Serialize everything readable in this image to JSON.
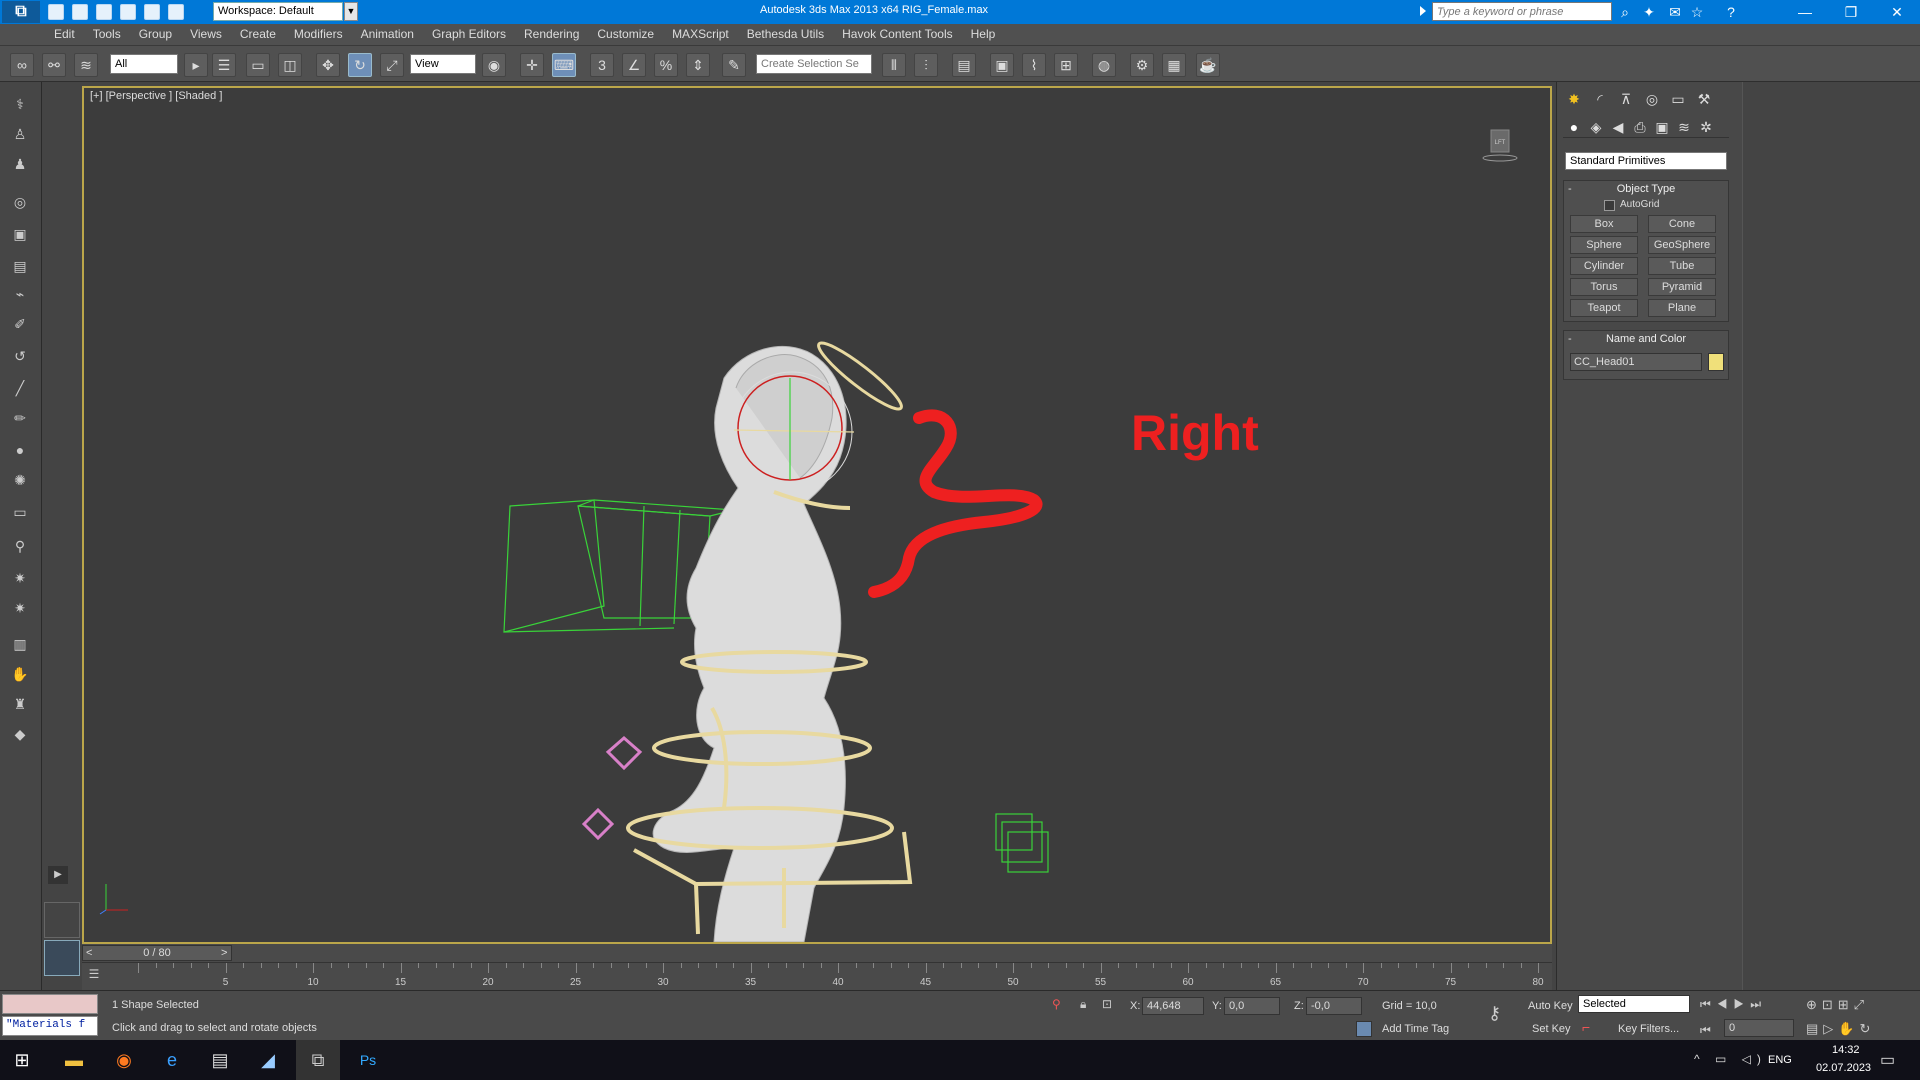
{
  "titlebar": {
    "workspace": "Workspace: Default",
    "app_title": "Autodesk 3ds Max  2013 x64     RIG_Female.max",
    "search_placeholder": "Type a keyword or phrase"
  },
  "menu": [
    "Edit",
    "Tools",
    "Group",
    "Views",
    "Create",
    "Modifiers",
    "Animation",
    "Graph Editors",
    "Rendering",
    "Customize",
    "MAXScript",
    "Bethesda Utils",
    "Havok Content Tools",
    "Help"
  ],
  "toolbar": {
    "filter_value": "All",
    "refcoord_value": "View",
    "selection_set_placeholder": "Create Selection Se",
    "snap_labels": [
      "3",
      "%"
    ]
  },
  "viewport": {
    "label": "[+] [Perspective ] [Shaded ]",
    "viewcube_label": "LFT",
    "annotation": "Right"
  },
  "timeslider": {
    "frame": "0 / 80",
    "prev": "<",
    "next": ">"
  },
  "track_ticks": [
    "5",
    "10",
    "15",
    "20",
    "25",
    "30",
    "35",
    "40",
    "45",
    "50",
    "55",
    "60",
    "65",
    "70",
    "75",
    "80"
  ],
  "command_panel": {
    "category": "Standard Primitives",
    "object_type_title": "Object Type",
    "autogrid": "AutoGrid",
    "buttons": [
      "Box",
      "Cone",
      "Sphere",
      "GeoSphere",
      "Cylinder",
      "Tube",
      "Torus",
      "Pyramid",
      "Teapot",
      "Plane"
    ],
    "name_color_title": "Name and Color",
    "object_name": "CC_Head01",
    "object_color": "#f0e07a"
  },
  "status": {
    "script_listener": "",
    "maxscript_line": "\"Materials f",
    "selection": "1 Shape Selected",
    "prompt": "Click and drag to select and rotate objects",
    "x_label": "X:",
    "x_value": "44,648",
    "y_label": "Y:",
    "y_value": "0,0",
    "z_label": "Z:",
    "z_value": "-0,0",
    "grid": "Grid = 10,0",
    "add_time_tag": "Add Time Tag",
    "auto_key": "Auto Key",
    "selected": "Selected",
    "set_key": "Set Key",
    "key_filters": "Key Filters...",
    "frame_value": "0"
  },
  "taskbar": {
    "lang": "ENG",
    "time": "14:32",
    "date": "02.07.2023"
  },
  "colors": {
    "title_blue": "#0078d7",
    "rig_gold": "#e8d9a0",
    "bone_green": "#39d339",
    "annot_red": "#ee2020"
  }
}
